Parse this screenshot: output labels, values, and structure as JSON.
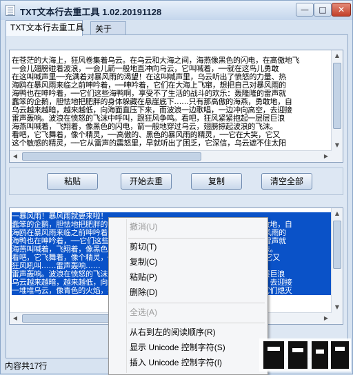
{
  "window": {
    "title": "TXT文本行去重工具 1.02.20191128",
    "min_glyph": "—",
    "max_glyph": "□",
    "close_glyph": "✕"
  },
  "tabs": [
    {
      "label": "TXT文本行去重工具"
    },
    {
      "label": "关于"
    }
  ],
  "input_text": [
    "在苍茫的大海上，狂风卷集着乌云。在乌云和大海之间，海燕像黑色的闪电，在高傲地飞",
    "一会儿翅膀碰着波浪，一会儿箭一般地直冲向乌云，它叫喊着，──就在这鸟儿勇敢",
    "在这叫喊声里──充满着对暴风雨的渴望！在这叫喊声里，乌云听出了愤怒的力量、热",
    "海鸥在暴风雨来临之前呻吟着，──呻吟着，它们在大海上飞窜，想把自己对暴风雨的",
    "海鸭也在呻吟着，──它们这些海鸭啊，享受不了生活的战斗的欢乐：轰隆隆的雷声就",
    "蠢笨的企鹅，胆怯地把肥胖的身体躲藏在悬崖底下……只有那高傲的海燕，勇敢地，自",
    "乌云越来越暗，越来越低，向海面直压下来，而波浪一边歌唱，一边冲向高空，去迎接",
    "雷声轰响。波浪在愤怒的飞沫中呼叫，跟狂风争鸣。看吧，狂风紧紧抱起一层层巨浪",
    "海燕叫喊着，飞翔着，像黑色的闪电，箭一般地穿过乌云，翅膀掠起波浪的飞沫。",
    "看吧，它飞舞着，像个精灵，──高傲的、黑色的暴风雨的精灵，──它在大笑，它又",
    "这个敏感的精灵，──它从雷声的震怒里，早就听出了困乏，它深信，乌云遮不住太阳"
  ],
  "buttons": {
    "paste": "粘贴",
    "dedupe": "开始去重",
    "copy": "复制",
    "clear_all": "清空全部"
  },
  "output_text": [
    "一暴风雨！暴风雨就要来啦！",
    "蠢笨的企鹅，胆怯地把肥胖的身体躲藏在悬崖底下……只有那高傲的海燕，勇敢地，自",
    "海鸥在暴风雨来临之前呻吟着，──呻吟着，它们在大海上飞窜，想把自己对暴风雨的",
    "海鸭也在呻吟着，──它们这些海鸭啊，享受不了生活的战斗的欢乐：轰隆隆的雷声就",
    "海燕叫喊着，飞翔着，像黑色的闪电，箭一般地穿过乌云，翅膀掠起波浪的飞沫。",
    "看吧，它飞舞着，像个精灵，──高傲的、黑色的暴风雨的精灵，──它在大笑，它又",
    "狂风吼叫……雷声轰响……",
    "雷声轰响。波浪在愤怒的飞沫中呼叫，跟狂风争鸣。看吧，狂风紧紧抱起一层层巨浪",
    "乌云越来越暗，越来越低，向海面直压下来，而波浪一边歌唱，一边冲向高空，去迎接",
    "一堆堆乌云，像青色的火焰，在无底的大海上燃烧。大海抓住闪电的箭光，把它们熄灭"
  ],
  "status": {
    "text": "内容共17行"
  },
  "context_menu": {
    "undo": "撤消(U)",
    "cut": "剪切(T)",
    "copy": "复制(C)",
    "paste": "粘贴(P)",
    "delete": "删除(D)",
    "select_all": "全选(A)",
    "rtl": "从右到左的阅读顺序(R)",
    "show_unicode": "显示 Unicode 控制字符(S)",
    "insert_unicode": "插入 Unicode 控制字符(I)"
  }
}
